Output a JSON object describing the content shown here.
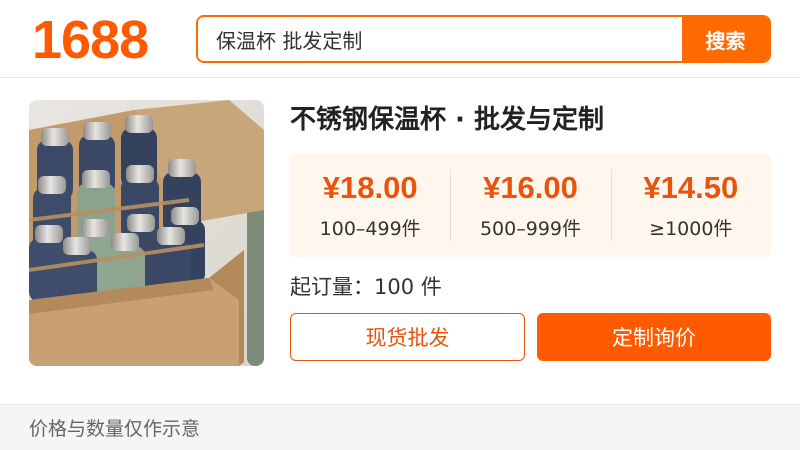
{
  "header": {
    "logo_text": "1688",
    "search": {
      "value": "保温杯 批发定制",
      "button_label": "搜索"
    }
  },
  "product": {
    "image_icon": "product-photo-insulated-bottles-in-box",
    "title": "不锈钢保温杯 · 批发与定制",
    "price_tiers": [
      {
        "price": "¥18.00",
        "range": "100–499件"
      },
      {
        "price": "¥16.00",
        "range": "500–999件"
      },
      {
        "price": "¥14.50",
        "range": "≥1000件"
      }
    ],
    "moq": "起订量：100 件",
    "actions": {
      "wholesale_label": "现货批发",
      "custom_label": "定制询价"
    }
  },
  "footer": {
    "note": "价格与数量仅作示意"
  },
  "colors": {
    "brand_orange": "#ff5a00",
    "price_red": "#e8540c",
    "price_panel_bg": "#fff6ee"
  }
}
